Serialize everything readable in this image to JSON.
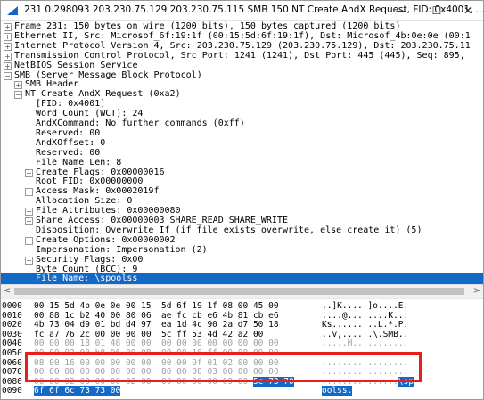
{
  "window": {
    "title": "231 0.298093 203.230.75.129 203.230.75.115 SMB 150 NT Create AndX Request, FID: 0x4001, ...",
    "controls": {
      "minimize": "—",
      "maximize": "☐",
      "close": "✕"
    }
  },
  "tree": {
    "rows": [
      {
        "text": "Frame 231: 150 bytes on wire (1200 bits), 150 bytes captured (1200 bits)",
        "expander": "+",
        "indent": 0
      },
      {
        "text": "Ethernet II, Src: Microsof_6f:19:1f (00:15:5d:6f:19:1f), Dst: Microsof_4b:0e:0e (00:1",
        "expander": "+",
        "indent": 0
      },
      {
        "text": "Internet Protocol Version 4, Src: 203.230.75.129 (203.230.75.129), Dst: 203.230.75.11",
        "expander": "+",
        "indent": 0
      },
      {
        "text": "Transmission Control Protocol, Src Port: 1241 (1241), Dst Port: 445 (445), Seq: 895,",
        "expander": "+",
        "indent": 0
      },
      {
        "text": "NetBIOS Session Service",
        "expander": "+",
        "indent": 0
      },
      {
        "text": "SMB (Server Message Block Protocol)",
        "expander": "−",
        "indent": 0
      },
      {
        "text": "SMB Header",
        "expander": "+",
        "indent": 1
      },
      {
        "text": "NT Create AndX Request (0xa2)",
        "expander": "−",
        "indent": 1
      },
      {
        "text": "[FID: 0x4001]",
        "expander": "",
        "indent": 2
      },
      {
        "text": "Word Count (WCT): 24",
        "expander": "",
        "indent": 2
      },
      {
        "text": "AndXCommand: No further commands (0xff)",
        "expander": "",
        "indent": 2
      },
      {
        "text": "Reserved: 00",
        "expander": "",
        "indent": 2
      },
      {
        "text": "AndXOffset: 0",
        "expander": "",
        "indent": 2
      },
      {
        "text": "Reserved: 00",
        "expander": "",
        "indent": 2
      },
      {
        "text": "File Name Len: 8",
        "expander": "",
        "indent": 2
      },
      {
        "text": "Create Flags: 0x00000016",
        "expander": "+",
        "indent": 2
      },
      {
        "text": "Root FID: 0x00000000",
        "expander": "",
        "indent": 2
      },
      {
        "text": "Access Mask: 0x0002019f",
        "expander": "+",
        "indent": 2
      },
      {
        "text": "Allocation Size: 0",
        "expander": "",
        "indent": 2
      },
      {
        "text": "File Attributes: 0x00000080",
        "expander": "+",
        "indent": 2
      },
      {
        "text": "Share Access: 0x00000003 SHARE_READ SHARE_WRITE",
        "expander": "+",
        "indent": 2
      },
      {
        "text": "Disposition: Overwrite If (if file exists overwrite, else create it) (5)",
        "expander": "",
        "indent": 2
      },
      {
        "text": "Create Options: 0x00000002",
        "expander": "+",
        "indent": 2
      },
      {
        "text": "Impersonation: Impersonation (2)",
        "expander": "",
        "indent": 2
      },
      {
        "text": "Security Flags: 0x00",
        "expander": "+",
        "indent": 2
      },
      {
        "text": "Byte Count (BCC): 9",
        "expander": "",
        "indent": 2
      },
      {
        "text": "File Name: \\spoolss",
        "expander": "",
        "indent": 2,
        "selected": true
      }
    ]
  },
  "hex": {
    "rows": [
      {
        "offset": "0000",
        "bytes": "00 15 5d 4b 0e 0e 00 15  5d 6f 19 1f 08 00 45 00",
        "ascii": "..]K.... ]o....E."
      },
      {
        "offset": "0010",
        "bytes": "00 88 1c b2 40 00 80 06  ae fc cb e6 4b 81 cb e6",
        "ascii": "....@... ....K..."
      },
      {
        "offset": "0020",
        "bytes": "4b 73 04 d9 01 bd d4 97  ea 1d 4c 90 2a d7 50 18",
        "ascii": "Ks...... ..L.*.P."
      },
      {
        "offset": "0030",
        "bytes": "fc a7 76 2c 00 00 00 00  5c ff 53 4d 42 a2 00",
        "ascii": "..v,.... .\\.SMB..",
        "dim_from": 8
      },
      {
        "offset": "0040",
        "bytes": "00 00 00 18 01 48 00 00  00 00 00 00 00 00 00 00",
        "ascii": ".....H.. ........",
        "dim": true
      },
      {
        "offset": "0050",
        "bytes": "00 00 02 08 b8 06 00 08  00 00 18 ff 00 00 00 00",
        "ascii": "........ ........",
        "dim": true
      },
      {
        "offset": "0060",
        "bytes": "08 00 16 00 00 00 00 00  00 00 9f 01 02 00 00 00",
        "ascii": "........ ........",
        "dim": true
      },
      {
        "offset": "0070",
        "bytes": "00 00 00 00 00 00 00 00  80 00 00 03 00 00 00 00",
        "ascii": "........ ........",
        "dim": true
      },
      {
        "offset": "0080",
        "bytes": "00 00 02 00 00 00 02 00  00 00 00 00 09 00 ",
        "hl_bytes": "5c 73 70",
        "ascii": "........ ......",
        "hl_ascii": "\\sp",
        "dim": true
      },
      {
        "offset": "0090",
        "bytes": "",
        "hl_bytes": "6f 6f 6c 73 73 00",
        "ascii": "",
        "hl_ascii": "oolss."
      }
    ]
  },
  "colors": {
    "selection": "#1469c7",
    "annotation_box": "#e8201d"
  }
}
